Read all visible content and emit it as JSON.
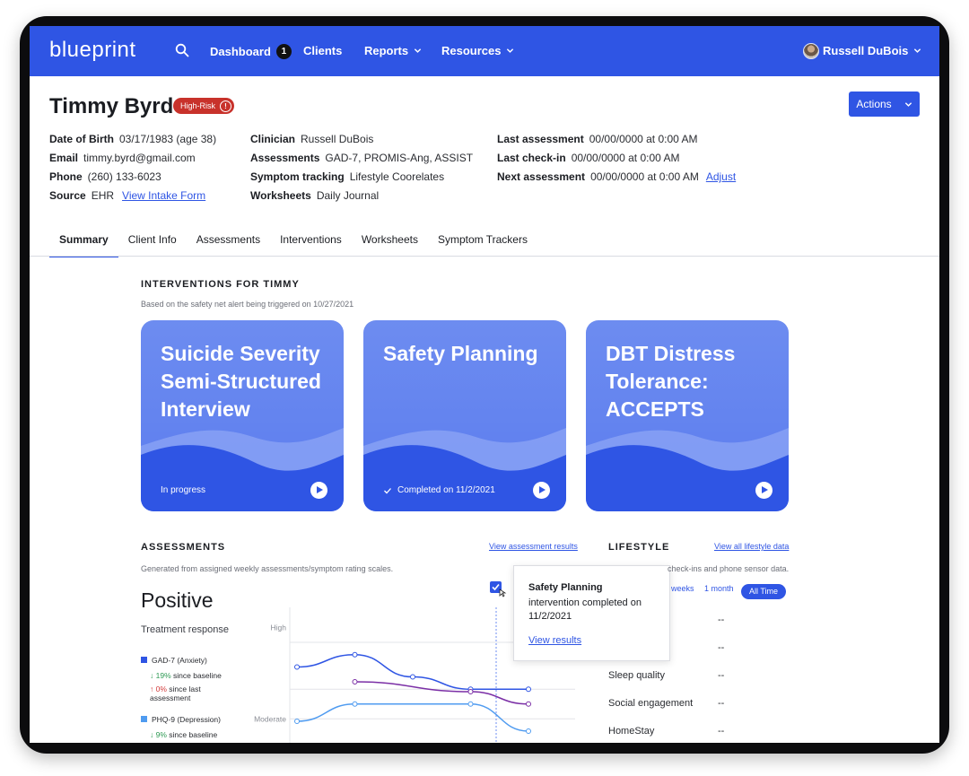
{
  "nav": {
    "logo": "blueprint",
    "items": [
      {
        "label": "Dashboard",
        "badge": "1"
      },
      {
        "label": "Clients"
      },
      {
        "label": "Reports"
      },
      {
        "label": "Resources"
      }
    ],
    "user": "Russell DuBois"
  },
  "client": {
    "name": "Timmy Byrd",
    "risk": "High-Risk",
    "actions": "Actions",
    "col1": [
      {
        "label": "Date of Birth",
        "value": "03/17/1983 (age 38)"
      },
      {
        "label": "Email",
        "value": "timmy.byrd@gmail.com"
      },
      {
        "label": "Phone",
        "value": "(260) 133-6023"
      },
      {
        "label": "Source",
        "value": "EHR",
        "link": "View Intake Form"
      }
    ],
    "col2": [
      {
        "label": "Clinician",
        "value": "Russell DuBois"
      },
      {
        "label": "Assessments",
        "value": "GAD-7, PROMIS-Ang, ASSIST"
      },
      {
        "label": "Symptom tracking",
        "value": "Lifestyle Coorelates"
      },
      {
        "label": "Worksheets",
        "value": "Daily Journal"
      }
    ],
    "col3": [
      {
        "label": "Last assessment",
        "value": "00/00/0000 at 0:00 AM"
      },
      {
        "label": "Last check-in",
        "value": "00/00/0000 at 0:00 AM"
      },
      {
        "label": "Next assessment",
        "value": "00/00/0000 at 0:00 AM",
        "link": "Adjust"
      }
    ]
  },
  "tabs": [
    "Summary",
    "Client Info",
    "Assessments",
    "Interventions",
    "Worksheets",
    "Symptom Trackers"
  ],
  "interventions": {
    "title": "INTERVENTIONS FOR TIMMY",
    "subtitle": "Based on the safety net alert being triggered on 10/27/2021",
    "cards": [
      {
        "title": "Suicide Severity Semi-Structured Interview",
        "status": "In progress"
      },
      {
        "title": "Safety Planning",
        "status": "Completed on  11/2/2021"
      },
      {
        "title": "DBT Distress Tolerance: ACCEPTS",
        "status": ""
      }
    ]
  },
  "assessments": {
    "title": "ASSESSMENTS",
    "link": "View assessment results",
    "subtitle": "Generated from assigned weekly assessments/symptom rating scales.",
    "status": "Positive",
    "response_label": "Treatment response",
    "legend": [
      {
        "name": "GAD-7 (Anxiety)",
        "color": "#2f55e4",
        "stat1_arrow": "↓",
        "stat1": "19%",
        "stat1_text": "since baseline",
        "stat2_arrow": "↑",
        "stat2": "0%",
        "stat2_text": "since last assessment"
      },
      {
        "name": "PHQ-9 (Depression)",
        "color": "#4f9bf0",
        "stat1_arrow": "↓",
        "stat1": "9%",
        "stat1_text": "since baseline"
      }
    ]
  },
  "tooltip": {
    "title": "Safety Planning",
    "body": "intervention completed on 11/2/2021",
    "link": "View results"
  },
  "lifestyle": {
    "title": "LIFESTYLE",
    "link": "View all lifestyle data",
    "subtitle": "check-ins and phone sensor data.",
    "ranges": [
      "weeks",
      "1 month"
    ],
    "active_range": "All Time",
    "rows": [
      {
        "label": "",
        "value": "--"
      },
      {
        "label": "",
        "value": "--"
      },
      {
        "label": "Sleep quality",
        "value": "--"
      },
      {
        "label": "Social engagement",
        "value": "--"
      },
      {
        "label": "HomeStay",
        "value": "--"
      }
    ]
  },
  "chart_data": {
    "type": "line",
    "y_ticks": [
      "High",
      "Moderate"
    ],
    "series": [
      {
        "color": "#2f55e4",
        "values": [
          [
            0,
            3.4
          ],
          [
            1,
            3.9
          ],
          [
            2,
            3.0
          ],
          [
            3,
            2.5
          ],
          [
            4,
            2.5
          ]
        ]
      },
      {
        "color": "#7b2fa6",
        "values": [
          [
            1,
            2.8
          ],
          [
            3,
            2.4
          ],
          [
            4,
            1.9
          ]
        ]
      },
      {
        "color": "#4f9bf0",
        "values": [
          [
            0,
            1.2
          ],
          [
            1,
            1.9
          ],
          [
            3,
            1.9
          ],
          [
            4,
            0.8
          ]
        ]
      }
    ]
  }
}
